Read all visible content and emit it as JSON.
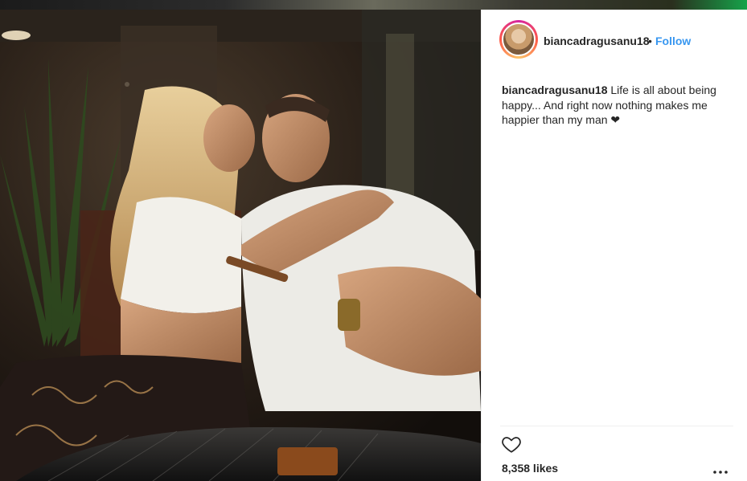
{
  "post": {
    "username": "biancadragusanu18",
    "separator": "•",
    "follow_label": "Follow",
    "caption_user": "biancadragusanu18",
    "caption_text": " Life is all about being happy... And right now nothing makes me happier than my man ",
    "caption_emoji": "❤",
    "likes": "8,358 likes"
  },
  "icons": {
    "like": "heart-outline-icon",
    "more": "more-options-icon"
  },
  "colors": {
    "link": "#3897f0",
    "text": "#262626",
    "divider": "#efefef"
  }
}
